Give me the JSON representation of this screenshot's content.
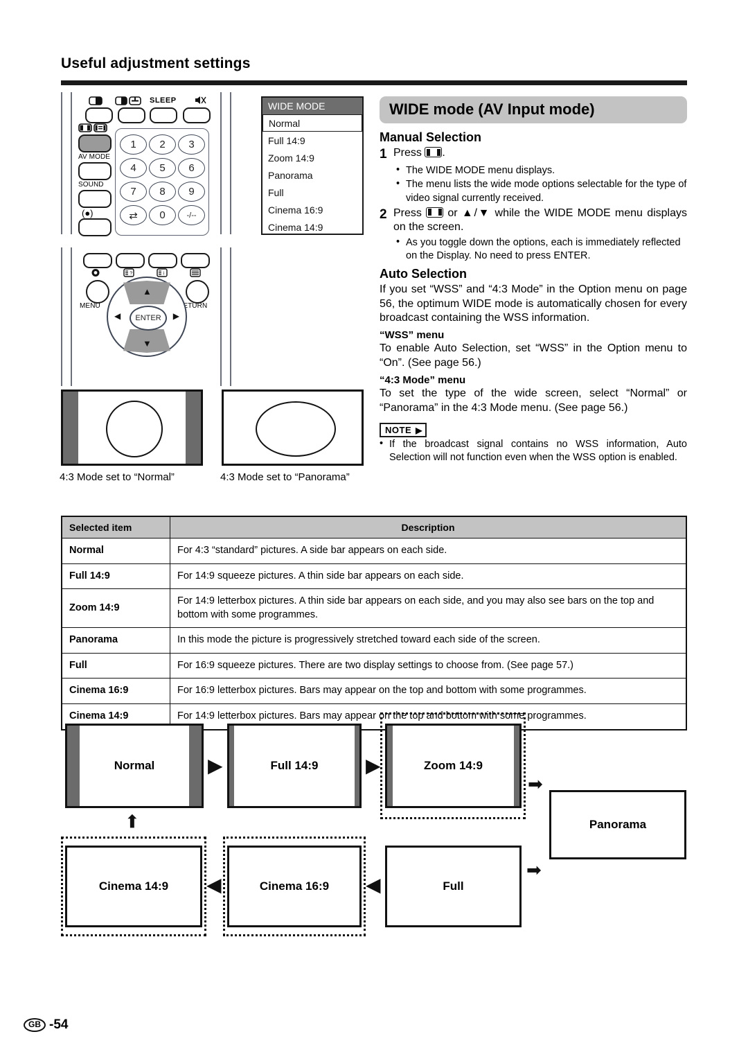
{
  "header": {
    "title": "Useful adjustment settings"
  },
  "osd": {
    "title": "WIDE MODE",
    "items": [
      "Normal",
      "Full 14:9",
      "Zoom 14:9",
      "Panorama",
      "Full",
      "Cinema 16:9",
      "Cinema 14:9"
    ],
    "selected": "Normal"
  },
  "remote": {
    "labels": {
      "sleep": "SLEEP",
      "av_mode": "AV MODE",
      "sound": "SOUND",
      "menu": "MENU",
      "return": "RETURN",
      "enter": "ENTER"
    },
    "keys": [
      "1",
      "2",
      "3",
      "4",
      "5",
      "6",
      "7",
      "8",
      "9",
      "⇄",
      "0",
      "-/--"
    ],
    "icons": {
      "contrast": "contrast-icon",
      "freeze": "freeze-icon",
      "subtitle": "subtitle-icon",
      "mute": "mute-icon",
      "wide": "wide-mode-icon",
      "wide2": "wide-mode-icon-2",
      "power": "power-icon",
      "teletext_reveal": "teletext-reveal-icon",
      "teletext_index": "teletext-index-icon",
      "teletext_menu": "teletext-menu-icon",
      "display": "display-icon",
      "up": "▲",
      "down": "▼",
      "left": "◀",
      "right": "▶"
    }
  },
  "main": {
    "badge_title": "WIDE mode (AV Input mode)",
    "manual_selection": {
      "heading": "Manual Selection",
      "steps": [
        {
          "num": "1",
          "pre": "Press",
          "post": ".",
          "bullets": [
            "The WIDE MODE menu displays.",
            "The menu lists the wide mode options selectable for the type of video signal currently received."
          ]
        },
        {
          "num": "2",
          "pre": "Press",
          "mid": "or ▲/▼ while the WIDE MODE menu displays on the screen.",
          "bullets": [
            "As you toggle down the options, each is immediately reflected on the Display. No need to press ENTER."
          ]
        }
      ]
    },
    "auto_selection": {
      "heading": "Auto Selection",
      "body": "If you set “WSS” and “4:3 Mode” in the Option menu on page 56, the optimum WIDE mode is automatically chosen for every broadcast containing the WSS information.",
      "wss_heading": "“WSS” menu",
      "wss_body": "To enable Auto Selection, set “WSS” in the Option menu to “On”. (See page 56.)",
      "mode43_heading": "“4:3 Mode” menu",
      "mode43_body": "To set the type of the wide screen, select “Normal” or “Panorama” in the 4:3 Mode menu. (See page 56.)"
    },
    "note": {
      "label": "NOTE",
      "items": [
        "If the broadcast signal contains no WSS information, Auto Selection will not function even when the WSS option is enabled."
      ]
    }
  },
  "figures": {
    "normal_caption": "4:3 Mode set to “Normal”",
    "panorama_caption": "4:3 Mode set to “Panorama”"
  },
  "table": {
    "columns": [
      "Selected item",
      "Description"
    ],
    "rows": [
      {
        "item": "Normal",
        "desc": "For 4:3 “standard” pictures. A side bar appears on each side."
      },
      {
        "item": "Full 14:9",
        "desc": "For 14:9 squeeze pictures. A thin side bar appears on each side."
      },
      {
        "item": "Zoom 14:9",
        "desc": "For 14:9 letterbox pictures. A thin side bar appears on each side, and you may also see bars on the top and bottom with some programmes."
      },
      {
        "item": "Panorama",
        "desc": "In this mode the picture is progressively stretched toward each side of the screen."
      },
      {
        "item": "Full",
        "desc": "For 16:9 squeeze pictures. There are two display settings to choose from. (See page 57.)"
      },
      {
        "item": "Cinema 16:9",
        "desc": "For 16:9 letterbox pictures. Bars may appear on the top and bottom with some programmes."
      },
      {
        "item": "Cinema 14:9",
        "desc": "For 14:9 letterbox pictures. Bars may appear on the top and bottom with some programmes."
      }
    ]
  },
  "flow": {
    "boxes": [
      {
        "label": "Normal",
        "dashed": false,
        "sidebars": "wide"
      },
      {
        "label": "Full 14:9",
        "dashed": false,
        "sidebars": "thin"
      },
      {
        "label": "Zoom 14:9",
        "dashed": true,
        "sidebars": "thin"
      },
      {
        "label": "Panorama",
        "dashed": false,
        "sidebars": "none"
      },
      {
        "label": "Full",
        "dashed": false,
        "sidebars": "none"
      },
      {
        "label": "Cinema 16:9",
        "dashed": true,
        "sidebars": "none"
      },
      {
        "label": "Cinema 14:9",
        "dashed": true,
        "sidebars": "none"
      }
    ],
    "arrows": [
      "▶",
      "▶",
      "↘",
      "↙",
      "◀",
      "◀",
      "▲"
    ]
  },
  "footer": {
    "region": "GB",
    "page": "-54"
  },
  "colors": {
    "rule": "#1a1a1a",
    "badge_bg": "#c3c3c3",
    "osd_header": "#6e6e6e",
    "sidebar_gray": "#6b6b6b"
  }
}
